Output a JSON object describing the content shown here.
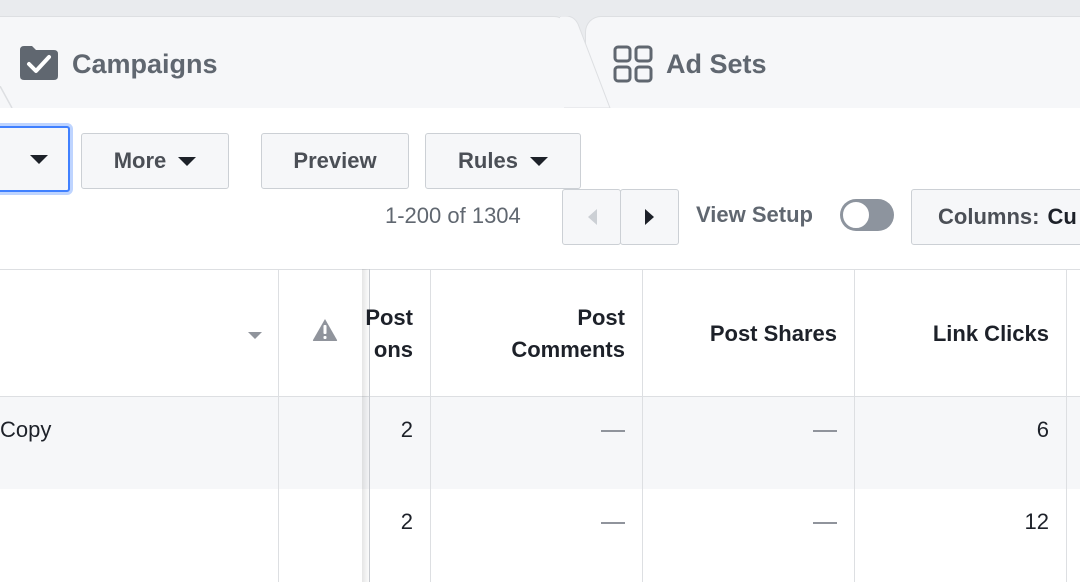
{
  "tabs": [
    {
      "label": "Campaigns",
      "icon": "folder-check-icon",
      "active": true
    },
    {
      "label": "Ad Sets",
      "icon": "grid-icon",
      "active": false
    }
  ],
  "toolbar": {
    "more_label": "More",
    "preview_label": "Preview",
    "rules_label": "Rules",
    "pager_text": "1-200 of 1304",
    "view_setup_label": "View Setup",
    "view_setup_on": false,
    "columns_label": "Columns:",
    "columns_value": "Cu"
  },
  "table": {
    "columns": [
      {
        "line1": "Post",
        "line2": "ons"
      },
      {
        "line1": "Post",
        "line2": "Comments"
      },
      {
        "line1": "Post Shares",
        "line2": ""
      },
      {
        "line1": "Link Clicks",
        "line2": ""
      }
    ],
    "rows": [
      {
        "name": "Copy",
        "reactions": "2",
        "comments": "—",
        "shares": "—",
        "link_clicks": "6"
      },
      {
        "name": "",
        "reactions": "2",
        "comments": "—",
        "shares": "—",
        "link_clicks": "12"
      }
    ]
  },
  "colors": {
    "accent_focus": "#4080ff",
    "header_text": "#1d2129",
    "muted_text": "#606770",
    "page_bg": "#e9ebee"
  }
}
